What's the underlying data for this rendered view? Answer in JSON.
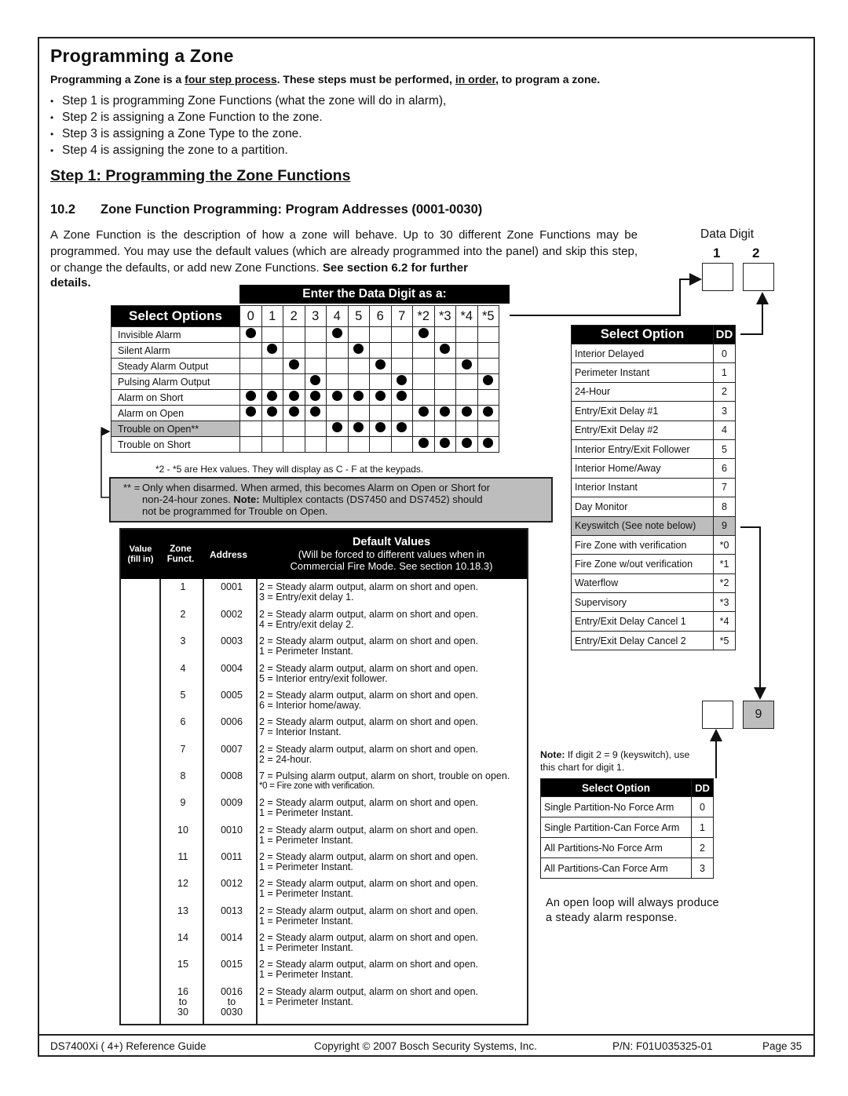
{
  "page": {
    "title": "Programming a Zone",
    "lead": {
      "part1": "Programming a Zone is a ",
      "u1": "four step process",
      "part2": ". These steps must be performed, ",
      "u2": "in order",
      "part3": ", to program a zone."
    },
    "steps": [
      "Step 1 is programming Zone Functions (what the zone will do in alarm),",
      "Step 2 is assigning a Zone Function to the zone.",
      "Step 3 is assigning a Zone Type to the zone.",
      "Step 4 is assigning the zone to a partition."
    ],
    "step_heading": "Step 1: Programming the Zone Functions",
    "section_number": "10.2",
    "section_title": "Zone Function Programming: Program Addresses (0001-0030)",
    "intro_text": "A Zone Function is the description of how a zone will behave. Up to 30 different Zone Functions may be programmed. You may use the default values (which are already programmed into the panel) and skip this step, or change the defaults, or add new Zone Functions. ",
    "intro_bold": "See section 6.2 for further",
    "intro_details": "details."
  },
  "options_matrix": {
    "enter_heading": "Enter the Data Digit as a:",
    "header": "Select Options",
    "digits": [
      "0",
      "1",
      "2",
      "3",
      "4",
      "5",
      "6",
      "7",
      "*2",
      "*3",
      "*4",
      "*5"
    ],
    "rows": [
      {
        "label": "Invisible Alarm",
        "marks": [
          1,
          0,
          0,
          0,
          1,
          0,
          0,
          0,
          1,
          0,
          0,
          0
        ]
      },
      {
        "label": "Silent Alarm",
        "marks": [
          0,
          1,
          0,
          0,
          0,
          1,
          0,
          0,
          0,
          1,
          0,
          0
        ]
      },
      {
        "label": "Steady Alarm Output",
        "marks": [
          0,
          0,
          1,
          0,
          0,
          0,
          1,
          0,
          0,
          0,
          1,
          0
        ]
      },
      {
        "label": "Pulsing Alarm Output",
        "marks": [
          0,
          0,
          0,
          1,
          0,
          0,
          0,
          1,
          0,
          0,
          0,
          1
        ]
      },
      {
        "label": "Alarm on Short",
        "marks": [
          1,
          1,
          1,
          1,
          1,
          1,
          1,
          1,
          0,
          0,
          0,
          0
        ]
      },
      {
        "label": "Alarm on Open",
        "marks": [
          1,
          1,
          1,
          1,
          0,
          0,
          0,
          0,
          1,
          1,
          1,
          1
        ]
      },
      {
        "label": "Trouble on Open**",
        "marks": [
          0,
          0,
          0,
          0,
          1,
          1,
          1,
          1,
          0,
          0,
          0,
          0
        ],
        "highlight": true
      },
      {
        "label": "Trouble on Short",
        "marks": [
          0,
          0,
          0,
          0,
          0,
          0,
          0,
          0,
          1,
          1,
          1,
          1
        ]
      }
    ],
    "hex_note": "*2 - *5 are Hex values. They will display as C - F at the keypads.",
    "footnote": {
      "marker": "** =",
      "line1": "Only when disarmed. When armed, this becomes Alarm on Open or Short for",
      "line2a": "non-24-hour zones. ",
      "line2b": "Note:",
      "line2c": " Multiplex contacts (DS7450 and DS7452) should",
      "line3": "not be programmed for Trouble on Open."
    }
  },
  "defaults_table": {
    "headers": {
      "value": "Value",
      "value_sub": "(fill in)",
      "zone": "Zone",
      "zone_sub": "Funct.",
      "address": "Address",
      "default_title": "Default Values",
      "default_sub1": "(Will be forced to different values when in",
      "default_sub2": "Commercial Fire Mode. See section 10.18.3)"
    },
    "rows": [
      {
        "zone": "1",
        "address": "0001",
        "line1": "2 = Steady alarm output, alarm on short and open.",
        "line2": "3 = Entry/exit delay 1."
      },
      {
        "zone": "2",
        "address": "0002",
        "line1": "2 = Steady alarm output, alarm on short and open.",
        "line2": "4 = Entry/exit delay 2."
      },
      {
        "zone": "3",
        "address": "0003",
        "line1": "2 = Steady alarm output, alarm on short and open.",
        "line2": "1 = Perimeter Instant."
      },
      {
        "zone": "4",
        "address": "0004",
        "line1": "2 = Steady alarm output, alarm on short and open.",
        "line2": "5 = Interior entry/exit follower."
      },
      {
        "zone": "5",
        "address": "0005",
        "line1": "2 = Steady alarm output, alarm on short and open.",
        "line2": "6 = Interior home/away."
      },
      {
        "zone": "6",
        "address": "0006",
        "line1": "2 = Steady alarm output, alarm on short and open.",
        "line2": "7 = Interior Instant."
      },
      {
        "zone": "7",
        "address": "0007",
        "line1": "2 = Steady alarm output, alarm on short and open.",
        "line2": "2 = 24-hour."
      },
      {
        "zone": "8",
        "address": "0008",
        "line1": "7 = Pulsing alarm output, alarm on short, trouble on open.",
        "line2": "*0 = Fire zone with verification.",
        "small": true
      },
      {
        "zone": "9",
        "address": "0009",
        "line1": "2 = Steady alarm output, alarm on short and open.",
        "line2": "1 = Perimeter Instant."
      },
      {
        "zone": "10",
        "address": "0010",
        "line1": "2 = Steady alarm output, alarm on short and open.",
        "line2": "1 = Perimeter Instant."
      },
      {
        "zone": "11",
        "address": "0011",
        "line1": "2 = Steady alarm output, alarm on short and open.",
        "line2": "1 = Perimeter Instant."
      },
      {
        "zone": "12",
        "address": "0012",
        "line1": "2 = Steady alarm output, alarm on short and open.",
        "line2": "1 = Perimeter Instant."
      },
      {
        "zone": "13",
        "address": "0013",
        "line1": "2 = Steady alarm output, alarm on short and open.",
        "line2": "1 = Perimeter Instant."
      },
      {
        "zone": "14",
        "address": "0014",
        "line1": "2 = Steady alarm output, alarm on short and open.",
        "line2": "1 = Perimeter Instant."
      },
      {
        "zone": "15",
        "address": "0015",
        "line1": "2 = Steady alarm output, alarm on short and open.",
        "line2": "1 = Perimeter Instant."
      },
      {
        "zone": "16\nto\n30",
        "address": "0016\nto\n0030",
        "line1": "2 = Steady alarm output, alarm on short and open.",
        "line2": "1 = Perimeter Instant."
      }
    ]
  },
  "data_digit": {
    "label": "Data Digit",
    "digit1": "1",
    "digit2": "2",
    "keyswitch_value": "9"
  },
  "zone_type_table": {
    "header": "Select Option",
    "dd_header": "DD",
    "rows": [
      {
        "label": "Interior Delayed",
        "dd": "0"
      },
      {
        "label": "Perimeter Instant",
        "dd": "1"
      },
      {
        "label": "24-Hour",
        "dd": "2"
      },
      {
        "label": "Entry/Exit Delay #1",
        "dd": "3"
      },
      {
        "label": "Entry/Exit Delay #2",
        "dd": "4"
      },
      {
        "label": "Interior Entry/Exit Follower",
        "dd": "5"
      },
      {
        "label": "Interior Home/Away",
        "dd": "6"
      },
      {
        "label": "Interior Instant",
        "dd": "7"
      },
      {
        "label": "Day Monitor",
        "dd": "8"
      },
      {
        "label": "Keyswitch (See note below)",
        "dd": "9",
        "highlight": true
      },
      {
        "label": "Fire Zone with verification",
        "dd": "*0"
      },
      {
        "label": "Fire Zone w/out verification",
        "dd": "*1"
      },
      {
        "label": "Waterflow",
        "dd": "*2"
      },
      {
        "label": "Supervisory",
        "dd": "*3"
      },
      {
        "label": "Entry/Exit Delay Cancel 1",
        "dd": "*4"
      },
      {
        "label": "Entry/Exit Delay Cancel 2",
        "dd": "*5"
      }
    ]
  },
  "keyswitch_note": {
    "bold": "Note:",
    "text1": " If digit 2 = 9 (keyswitch), use",
    "text2": "this chart for digit 1."
  },
  "partition_table": {
    "header": "Select Option",
    "dd_header": "DD",
    "rows": [
      {
        "label": "Single Partition-No Force Arm",
        "dd": "0"
      },
      {
        "label": "Single Partition-Can Force Arm",
        "dd": "1"
      },
      {
        "label": "All Partitions-No Force Arm",
        "dd": "2"
      },
      {
        "label": "All Partitions-Can Force Arm",
        "dd": "3"
      }
    ]
  },
  "open_loop_note": {
    "line1": "An open loop will always produce",
    "line2": "a steady alarm response."
  },
  "footer": {
    "guide": "DS7400Xi ( 4+) Reference Guide",
    "copyright": "Copyright © 2007 Bosch Security Systems, Inc.",
    "part_number": "P/N: F01U035325-01",
    "page": "Page 35"
  }
}
